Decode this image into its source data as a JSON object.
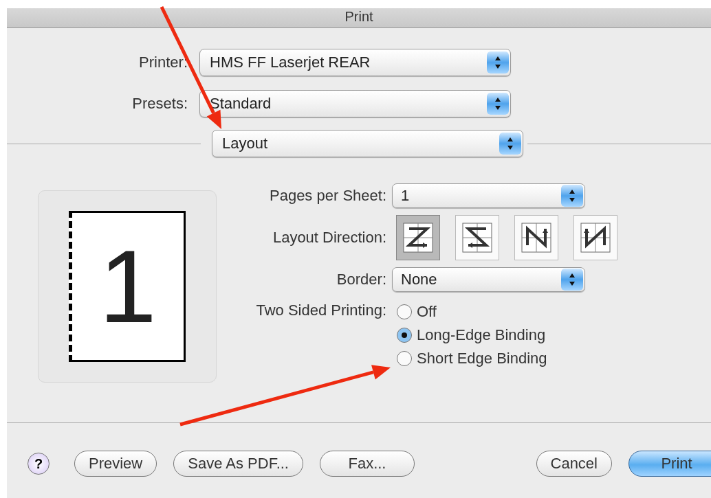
{
  "window": {
    "title": "Print"
  },
  "top_fields": [
    {
      "label": "Printer:",
      "value": "HMS FF Laserjet REAR"
    },
    {
      "label": "Presets:",
      "value": "Standard"
    }
  ],
  "pane_menu": {
    "value": "Layout"
  },
  "preview": {
    "page_number": "1"
  },
  "pages_per_sheet": {
    "label": "Pages per Sheet:",
    "value": "1"
  },
  "layout_direction": {
    "label": "Layout Direction:",
    "options": [
      {
        "kind": "z",
        "selected": true
      },
      {
        "kind": "s",
        "selected": false
      },
      {
        "kind": "n",
        "selected": false
      },
      {
        "kind": "n-reverse",
        "selected": false
      }
    ]
  },
  "border": {
    "label": "Border:",
    "value": "None"
  },
  "two_sided": {
    "label": "Two Sided Printing:",
    "options": [
      {
        "label": "Off",
        "selected": false
      },
      {
        "label": "Long-Edge Binding",
        "selected": true
      },
      {
        "label": "Short Edge Binding",
        "selected": false
      }
    ]
  },
  "help_button": "?",
  "buttons_left": [
    "Preview",
    "Save As PDF...",
    "Fax..."
  ],
  "buttons_right": [
    {
      "label": "Cancel",
      "default": false
    },
    {
      "label": "Print",
      "default": true
    }
  ],
  "annotations": [
    {
      "kind": "arrow"
    },
    {
      "kind": "arrow"
    }
  ]
}
